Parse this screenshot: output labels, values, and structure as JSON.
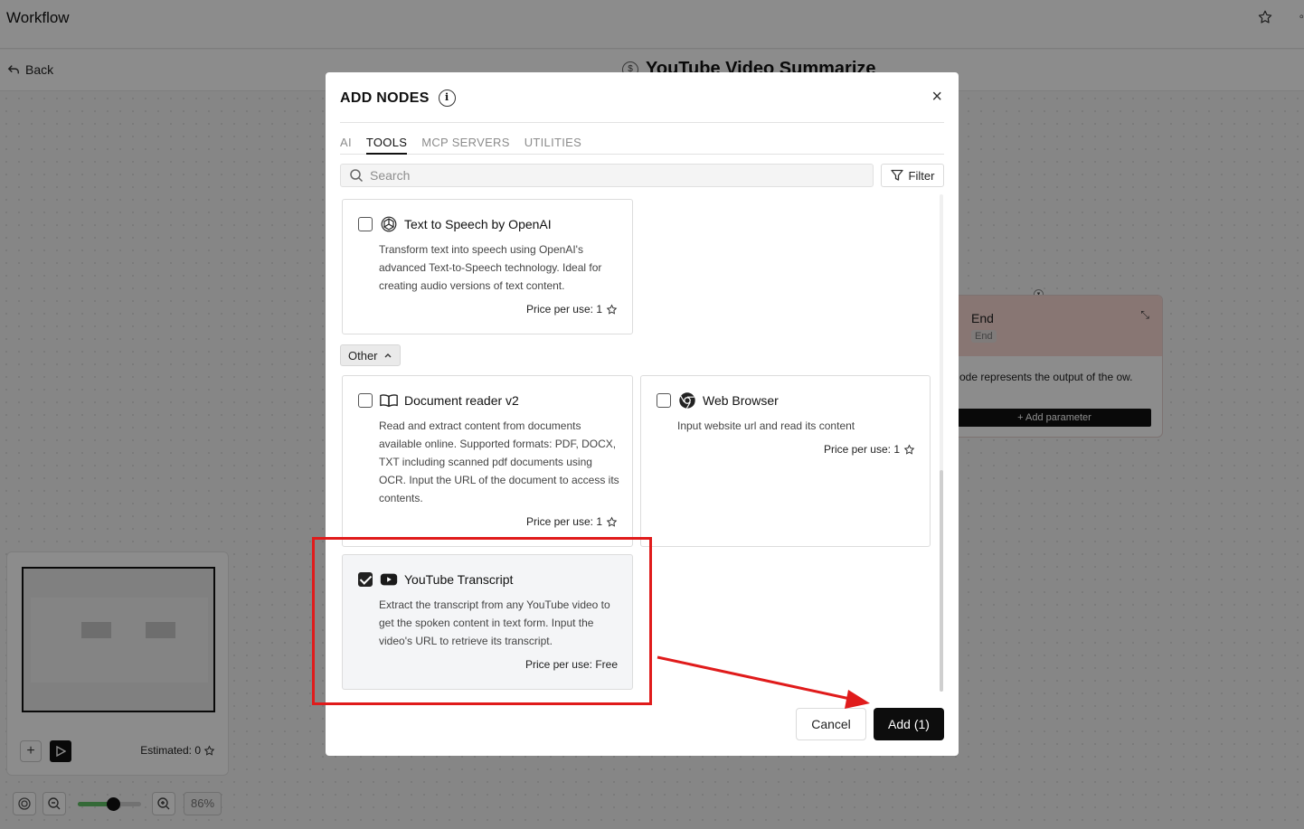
{
  "app": {
    "title": "Workflow",
    "back_label": "Back",
    "workflow_title": "YouTube Video Summarize",
    "workflow_icon_glyph": "$"
  },
  "end_node": {
    "name": "End",
    "tag": "End",
    "description": "ode represents the output of the ow.",
    "add_parameter_label": "+ Add parameter"
  },
  "minimap": {
    "estimated_label": "Estimated: 0",
    "zoom_percent": "86%",
    "zoom_level_fraction": 0.55
  },
  "modal": {
    "title": "ADD NODES",
    "info_glyph": "i",
    "close_glyph": "×",
    "tabs": [
      {
        "label": "AI",
        "active": false
      },
      {
        "label": "TOOLS",
        "active": true
      },
      {
        "label": "MCP SERVERS",
        "active": false
      },
      {
        "label": "UTILITIES",
        "active": false
      }
    ],
    "search_placeholder": "Search",
    "filter_label": "Filter",
    "group_label": "Other",
    "cards": [
      {
        "name": "Text to Speech by OpenAI",
        "icon": "openai-icon",
        "description": "Transform text into speech using OpenAI's advanced Text-to-Speech technology. Ideal for creating audio versions of text content.",
        "price": "Price per use: 1",
        "checked": false
      },
      {
        "name": "Document reader v2",
        "icon": "book-icon",
        "description": "Read and extract content from documents available online. Supported formats: PDF, DOCX, TXT including scanned pdf documents using OCR. Input the URL of the document to access its contents.",
        "price": "Price per use: 1",
        "checked": false
      },
      {
        "name": "Web Browser",
        "icon": "chrome-icon",
        "description": "Input website url and read its content",
        "price": "Price per use: 1",
        "checked": false
      },
      {
        "name": "YouTube Transcript",
        "icon": "youtube-icon",
        "description": "Extract the transcript from any YouTube video to get the spoken content in text form. Input the video's URL to retrieve its transcript.",
        "price": "Price per use: Free",
        "checked": true
      }
    ],
    "cancel_label": "Cancel",
    "add_label": "Add (1)"
  },
  "colors": {
    "annotation": "#e01b1b",
    "end_node_header": "#f7d7d2",
    "primary_button": "#0d0d0d",
    "zoom_fill": "#5fbf64"
  }
}
